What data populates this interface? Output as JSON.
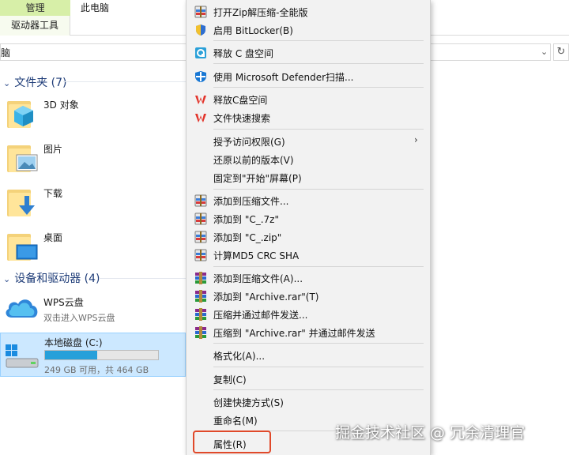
{
  "ribbon": {
    "tab_manage": "管理",
    "tab_this_pc": "此电脑",
    "tab_drive_tools": "驱动器工具"
  },
  "address": {
    "text": "脑",
    "chevron": "⌄",
    "refresh": "↻"
  },
  "groups": {
    "folders": "文件夹 (7)",
    "devices": "设备和驱动器 (4)"
  },
  "folders": [
    {
      "label": "3D 对象",
      "icon": "3d-objects-folder-icon"
    },
    {
      "label": "图片",
      "icon": "pictures-folder-icon"
    },
    {
      "label": "下载",
      "icon": "downloads-folder-icon"
    },
    {
      "label": "桌面",
      "icon": "desktop-folder-icon"
    }
  ],
  "wps": {
    "title": "WPS云盘",
    "subtitle": "双击进入WPS云盘"
  },
  "drive": {
    "title": "本地磁盘 (C:)",
    "usage_fraction": 0.46,
    "subtitle": "249 GB 可用，共 464 GB"
  },
  "menu": {
    "items": [
      {
        "label": "打开Zip解压缩-全能版",
        "icon": "zip-archive-icon"
      },
      {
        "label": "启用 BitLocker(B)",
        "icon": "shield-icon"
      },
      {
        "label": "释放 C 盘空间",
        "icon": "cleanup-icon"
      },
      {
        "label": "使用 Microsoft Defender扫描...",
        "icon": "defender-icon"
      },
      {
        "label": "释放C盘空间",
        "icon": "wps-icon"
      },
      {
        "label": "文件快速搜索",
        "icon": "wps-icon"
      },
      {
        "label": "授予访问权限(G)",
        "icon": ""
      },
      {
        "label": "还原以前的版本(V)",
        "icon": ""
      },
      {
        "label": "固定到\"开始\"屏幕(P)",
        "icon": ""
      },
      {
        "label": "添加到压缩文件...",
        "icon": "compress-icon"
      },
      {
        "label": "添加到 \"C_.7z\"",
        "icon": "compress-icon"
      },
      {
        "label": "添加到 \"C_.zip\"",
        "icon": "compress-icon"
      },
      {
        "label": "计算MD5 CRC SHA",
        "icon": "compress-icon"
      },
      {
        "label": "添加到压缩文件(A)...",
        "icon": "winrar-icon"
      },
      {
        "label": "添加到 \"Archive.rar\"(T)",
        "icon": "winrar-icon"
      },
      {
        "label": "压缩并通过邮件发送...",
        "icon": "winrar-icon"
      },
      {
        "label": "压缩到 \"Archive.rar\" 并通过邮件发送",
        "icon": "winrar-icon"
      },
      {
        "label": "格式化(A)...",
        "icon": ""
      },
      {
        "label": "复制(C)",
        "icon": ""
      },
      {
        "label": "创建快捷方式(S)",
        "icon": ""
      },
      {
        "label": "重命名(M)",
        "icon": ""
      },
      {
        "label": "属性(R)",
        "icon": ""
      }
    ],
    "submenu_arrow": "›"
  },
  "watermark": "掘金技术社区 @ 冗余清理官",
  "colors": {
    "ribbon_manage_tab": "#d7efa8",
    "group_header": "#1e3c78",
    "selection_bg": "#cce8ff",
    "selection_border": "#99d1ff",
    "drive_bar": "#26a0da",
    "menu_bg": "#f2f2f2",
    "highlight_box": "#e0492a"
  }
}
